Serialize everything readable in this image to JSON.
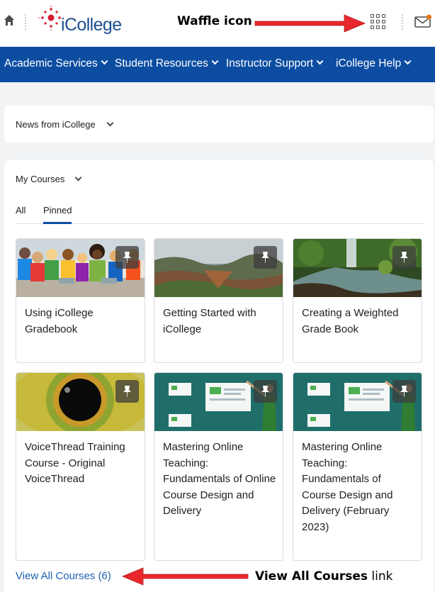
{
  "header": {
    "logo_text": "iCollege",
    "waffle_callout": "Waffle icon"
  },
  "nav": {
    "items": [
      {
        "label": "Academic Services"
      },
      {
        "label": "Student Resources"
      },
      {
        "label": "Instructor Support"
      },
      {
        "label": "iCollege Help"
      }
    ]
  },
  "news": {
    "title": "News from iCollege"
  },
  "courses": {
    "title": "My Courses",
    "tabs": [
      {
        "label": "All",
        "active": false
      },
      {
        "label": "Pinned",
        "active": true
      }
    ],
    "cards": [
      {
        "title": "Using iCollege Gradebook",
        "image": "group-with-devices-photo"
      },
      {
        "title": "Getting Started with iCollege",
        "image": "canyon-landscape-photo"
      },
      {
        "title": "Creating a Weighted Grade Book",
        "image": "forest-waterfall-photo"
      },
      {
        "title": "VoiceThread Training Course - Original VoiceThread",
        "image": "eye-closeup-photo"
      },
      {
        "title": "Mastering Online Teaching: Fundamentals of Online Course Design and Delivery",
        "image": "teaching-illustration"
      },
      {
        "title": "Mastering Online Teaching: Fundamentals of Course Design and Delivery (February 2023)",
        "image": "teaching-illustration"
      }
    ],
    "view_all_label": "View All Courses (6)",
    "view_all_callout_bold": "View All Courses",
    "view_all_callout_rest": " link"
  },
  "colors": {
    "nav_bg": "#0c4da2",
    "link": "#1f63b4",
    "callout_arrow": "#e8272c",
    "notification_dot": "#e87511",
    "logo_red": "#d7192b"
  }
}
